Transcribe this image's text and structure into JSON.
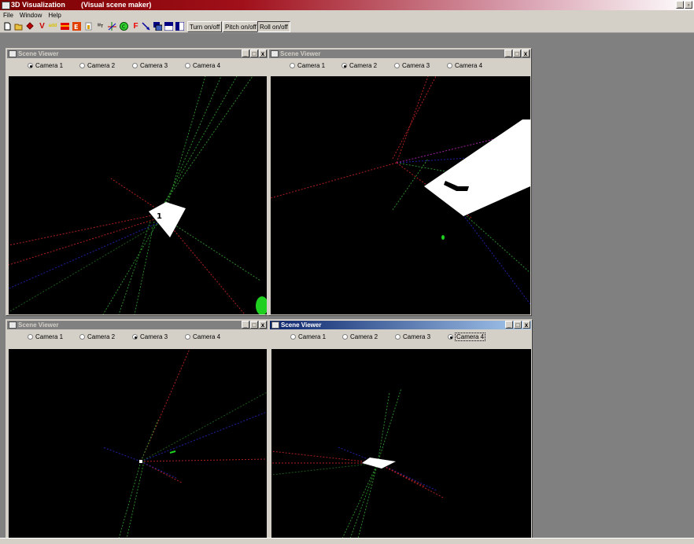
{
  "app": {
    "title": "3D Visualization",
    "subtitle": "(Visual scene maker)"
  },
  "menu": [
    "File",
    "Window",
    "Help"
  ],
  "toolbar": {
    "icons": [
      "new-file-icon",
      "open-folder-icon",
      "diamond-icon",
      "v-icon",
      "add-icon",
      "red-block-icon",
      "e-icon",
      "info-icon",
      "measure-icon",
      "axes-icon",
      "green-circle-icon",
      "f-icon",
      "arrow-icon",
      "stack-icon",
      "rows-icon",
      "columns-icon"
    ],
    "buttons": {
      "turn": "Turn on/off",
      "pitch": "Pitch on/off",
      "roll": "Roll on/off"
    }
  },
  "viewers": [
    {
      "title": "Scene Viewer",
      "selected": 0,
      "active": false
    },
    {
      "title": "Scene Viewer",
      "selected": 1,
      "active": false
    },
    {
      "title": "Scene Viewer",
      "selected": 2,
      "active": false
    },
    {
      "title": "Scene Viewer",
      "selected": 3,
      "active": true
    }
  ],
  "cameras": [
    "Camera 1",
    "Camera 2",
    "Camera 3",
    "Camera 4"
  ],
  "scene_labels": {
    "v1": "1",
    "v2": "1"
  },
  "colors": {
    "title_bar": "#7b0000",
    "active_window": "#0a246a",
    "view_background": "#000000",
    "desktop": "#808080"
  }
}
